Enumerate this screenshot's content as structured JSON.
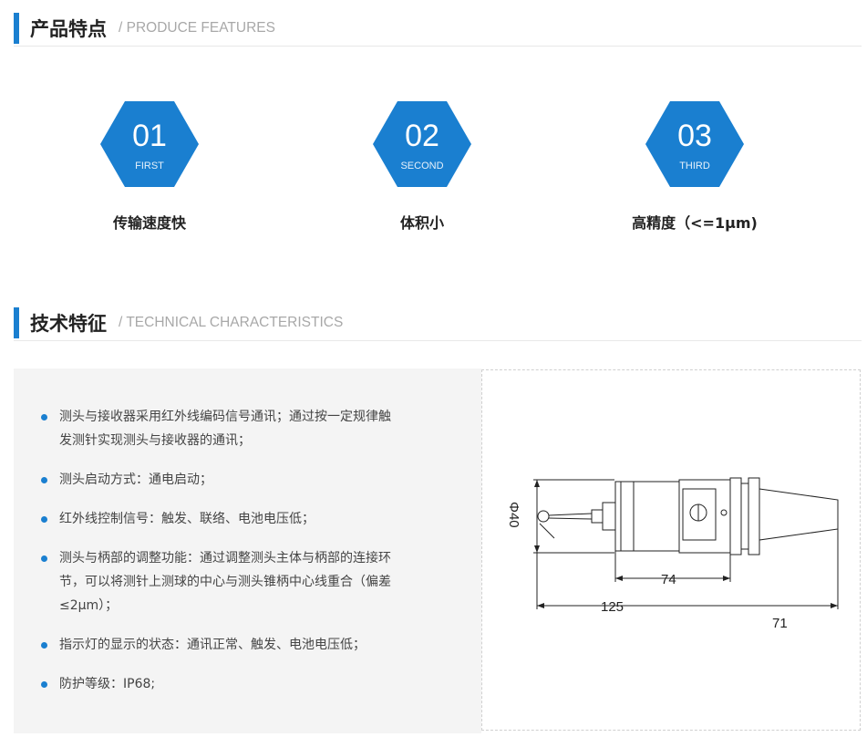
{
  "features_section": {
    "title": "产品特点",
    "subtitle": "/ PRODUCE FEATURES",
    "items": [
      {
        "number": "01",
        "label": "FIRST",
        "name": "传输速度快"
      },
      {
        "number": "02",
        "label": "SECOND",
        "name": "体积小"
      },
      {
        "number": "03",
        "label": "THIRD",
        "name": "高精度（<=1μm)"
      }
    ]
  },
  "tech_section": {
    "title": "技术特征",
    "subtitle": "/ TECHNICAL CHARACTERISTICS",
    "items": [
      {
        "line1": "测头与接收器采用红外线编码信号通讯；通过按一定规律触",
        "line2": "发测针实现测头与接收器的通讯；",
        "line3": ""
      },
      {
        "line1": "测头启动方式：通电启动；",
        "line2": "",
        "line3": ""
      },
      {
        "line1": "红外线控制信号：触发、联络、电池电压低；",
        "line2": "",
        "line3": ""
      },
      {
        "line1": "测头与柄部的调整功能：通过调整测头主体与柄部的连接环",
        "line2": "节，可以将测针上测球的中心与测头锥柄中心线重合（偏差",
        "line3": "≤2μm）；"
      },
      {
        "line1": "指示灯的显示的状态：通讯正常、触发、电池电压低；",
        "line2": "",
        "line3": ""
      },
      {
        "line1": "防护等级：IP68;",
        "line2": "",
        "line3": ""
      }
    ]
  },
  "diagram": {
    "dim_diameter": "Φ40",
    "dim_74": "74",
    "dim_125": "125",
    "dim_71": "71"
  },
  "colors": {
    "accent": "#1a7fd0"
  }
}
